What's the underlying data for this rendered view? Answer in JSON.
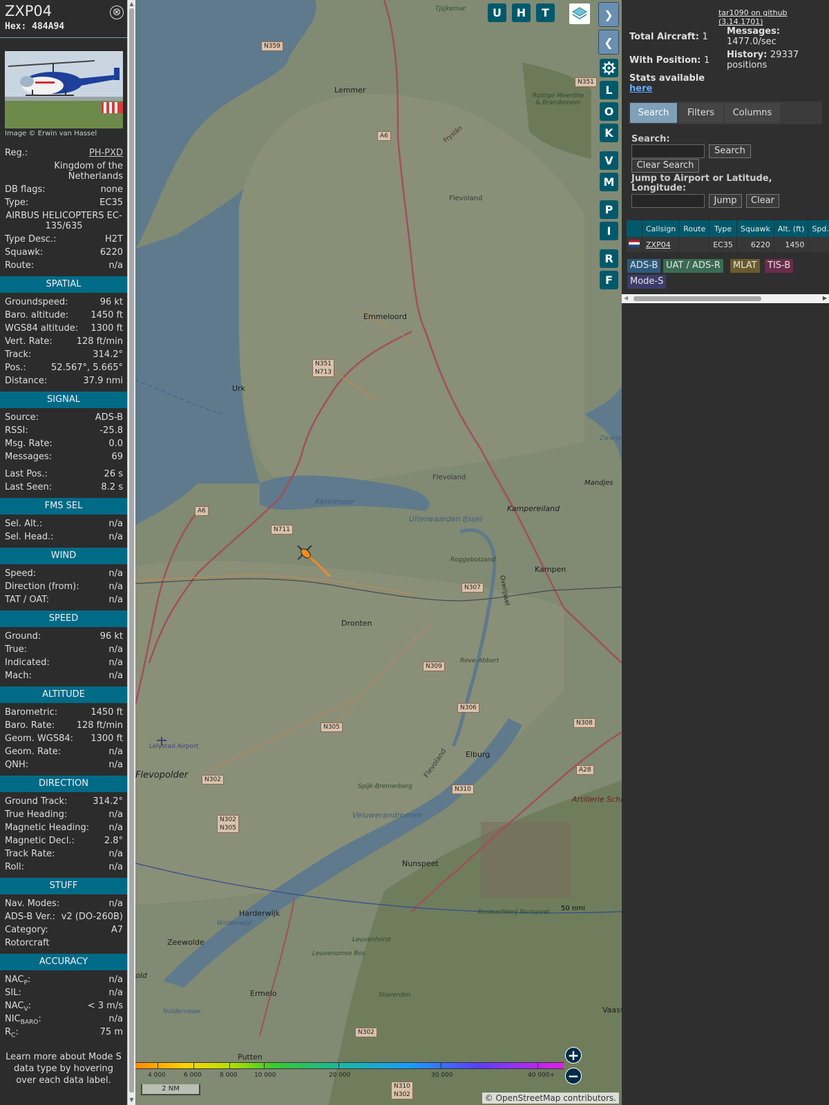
{
  "info": {
    "callsign": "ZXP04",
    "hex_label": "Hex:",
    "hex_value": "484A94",
    "close_glyph": "⊗",
    "photo_credit": "Image © Erwin van Hassel",
    "reg_label": "Reg.:",
    "reg_value": "PH-PXD",
    "country": "Kingdom of the Netherlands",
    "db_flags_label": "DB flags:",
    "db_flags_value": "none",
    "type_label": "Type:",
    "type_value": "EC35",
    "type_full": "AIRBUS HELICOPTERS EC-135/635",
    "type_desc_label": "Type Desc.:",
    "type_desc_value": "H2T",
    "squawk_label": "Squawk:",
    "squawk_value": "6220",
    "route_label": "Route:",
    "route_value": "n/a",
    "spatial_title": "SPATIAL",
    "groundspeed_label": "Groundspeed:",
    "groundspeed_value": "96 kt",
    "baro_alt_label": "Baro. altitude:",
    "baro_alt_value": "1450 ft",
    "wgs_alt_label": "WGS84 altitude:",
    "wgs_alt_value": "1300 ft",
    "vert_rate_label": "Vert. Rate:",
    "vert_rate_value": "128 ft/min",
    "track_label": "Track:",
    "track_value": "314.2°",
    "pos_label": "Pos.:",
    "pos_value": "52.567°, 5.665°",
    "distance_label": "Distance:",
    "distance_value": "37.9 nmi",
    "signal_title": "SIGNAL",
    "source_label": "Source:",
    "source_value": "ADS-B",
    "rssi_label": "RSSI:",
    "rssi_value": "-25.8",
    "msg_rate_label": "Msg. Rate:",
    "msg_rate_value": "0.0",
    "messages_label": "Messages:",
    "messages_value": "69",
    "last_pos_label": "Last Pos.:",
    "last_pos_value": "26 s",
    "last_seen_label": "Last Seen:",
    "last_seen_value": "8.2 s",
    "fms_title": "FMS SEL",
    "sel_alt_label": "Sel. Alt.:",
    "sel_alt_value": "n/a",
    "sel_head_label": "Sel. Head.:",
    "sel_head_value": "n/a",
    "wind_title": "WIND",
    "wind_speed_label": "Speed:",
    "wind_speed_value": "n/a",
    "wind_dir_label": "Direction (from):",
    "wind_dir_value": "n/a",
    "tat_label": "TAT / OAT:",
    "tat_value": "n/a",
    "speed_title": "SPEED",
    "ground_label": "Ground:",
    "ground_value": "96 kt",
    "true_label": "True:",
    "true_value": "n/a",
    "indicated_label": "Indicated:",
    "indicated_value": "n/a",
    "mach_label": "Mach:",
    "mach_value": "n/a",
    "altitude_title": "ALTITUDE",
    "barometric_label": "Barometric:",
    "barometric_value": "1450 ft",
    "baro_rate_label": "Baro. Rate:",
    "baro_rate_value": "128 ft/min",
    "geom_wgs_label": "Geom. WGS84:",
    "geom_wgs_value": "1300 ft",
    "geom_rate_label": "Geom. Rate:",
    "geom_rate_value": "n/a",
    "qnh_label": "QNH:",
    "qnh_value": "n/a",
    "direction_title": "DIRECTION",
    "ground_track_label": "Ground Track:",
    "ground_track_value": "314.2°",
    "true_heading_label": "True Heading:",
    "true_heading_value": "n/a",
    "mag_heading_label": "Magnetic Heading:",
    "mag_heading_value": "n/a",
    "mag_decl_label": "Magnetic Decl.:",
    "mag_decl_value": "2.8°",
    "track_rate_label": "Track Rate:",
    "track_rate_value": "n/a",
    "roll_label": "Roll:",
    "roll_value": "n/a",
    "stuff_title": "STUFF",
    "nav_modes_label": "Nav. Modes:",
    "nav_modes_value": "n/a",
    "adsb_ver_label": "ADS-B Ver.:",
    "adsb_ver_value": "v2 (DO-260B)",
    "category_label": "Category:",
    "category_value": "A7",
    "category_desc": "Rotorcraft",
    "accuracy_title": "ACCURACY",
    "nacp_label": "NAC",
    "nacp_sub": "P",
    "nacp_value": "n/a",
    "sil_label": "SIL:",
    "sil_value": "n/a",
    "nacv_label": "NAC",
    "nacv_sub": "V",
    "nacv_value": "< 3 m/s",
    "nic_label": "NIC",
    "nic_sub": "BARO",
    "nic_value": "n/a",
    "rc_label": "R",
    "rc_sub": "C",
    "rc_value": "75 m",
    "footer_note": "Learn more about Mode S data type by hovering over each data label."
  },
  "map": {
    "buttons": {
      "u": "U",
      "h": "H",
      "t": "T",
      "l": "L",
      "o": "O",
      "k": "K",
      "v": "V",
      "m": "M",
      "p": "P",
      "i": "I",
      "r": "R",
      "f": "F"
    },
    "toggle_glyph": "◂▸",
    "expand_glyph": "❯",
    "collapse_glyph": "❮",
    "settings_icon": "gear-icon",
    "layers_icon": "layers-icon",
    "zoom_in": "+",
    "zoom_out": "−",
    "scale_label": "2 NM",
    "range_ring_label": "50 nmi",
    "attribution": "© OpenStreetMap contributors.",
    "altitude_scale": [
      "4 000",
      "6 000",
      "8 000",
      "10 000",
      "20 000",
      "30 000",
      "40 000+"
    ],
    "places": {
      "lemmer": "Lemmer",
      "emmeloord": "Emmeloord",
      "urk": "Urk",
      "ketelmeer": "Ketelmeer",
      "uiterwaarden": "Uiterwaarden IJssel",
      "kampereiland": "Kampereiland",
      "kampen": "Kampen",
      "dronten": "Dronten",
      "flevoland1": "Flevoland",
      "flevoland2": "Flevoland",
      "flevoland3": "Flevoland",
      "reve": "Reve-Abbert",
      "roggebot": "Roggebotzand",
      "elburg": "Elburg",
      "lelystad": "Lelystad Airport",
      "flevopolder": "Flevopolder",
      "spijk": "Spijk-Bremerberg",
      "veluwe": "Veluwerandmeren",
      "nunspeet": "Nunspeet",
      "boswachterij": "Boswachterij Nunspeet",
      "harderwijk": "Harderwijk",
      "zeewolde": "Zeewolde",
      "ermelo": "Ermelo",
      "putten": "Putten",
      "leuvenhorst": "Leuvenhorst",
      "staverden": "Staverden",
      "leuvenumse": "Leuvenumse Bos",
      "wolderwijd": "Wolderwijd",
      "nuldernauw": "Nuldernauw",
      "artillerie": "Artillerie Schietkamp",
      "mandjes": "Mandjes",
      "zwarte": "Zwarte Meer",
      "rottige": "Rottige Meenthe & Brandemeer",
      "tjsjkemar": "Tjsjkemar",
      "fryslan": "Fryslân",
      "vaassen": "Vaass",
      "oold": "old",
      "overijssel": "Overijssel"
    },
    "roads": {
      "n359": "N359",
      "n351a": "N351",
      "n351b": "N351\nN713",
      "a6a": "A6",
      "a6b": "A6",
      "n711": "N711",
      "n307": "N307",
      "n309": "N309",
      "n306": "N306",
      "n305": "N305",
      "n302a": "N302",
      "n302b": "N302\nN305",
      "n310": "N310",
      "n308": "N308",
      "a28": "A28",
      "n302c": "N302",
      "n310b": "N310\nN302"
    }
  },
  "sidebar": {
    "github_link": "tar1090 on github (3.14.1701)",
    "total_aircraft_label": "Total Aircraft:",
    "total_aircraft_value": "1",
    "with_position_label": "With Position:",
    "with_position_value": "1",
    "messages_label": "Messages:",
    "messages_value": "1477.0/sec",
    "history_label": "History:",
    "history_value": "29337 positions",
    "stats_label": "Stats available",
    "stats_link": "here",
    "tabs": [
      "Search",
      "Filters",
      "Columns"
    ],
    "search_label": "Search:",
    "search_button": "Search",
    "clear_search_button": "Clear Search",
    "jump_label": "Jump to Airport or Latitude, Longitude:",
    "jump_button": "Jump",
    "clear_button": "Clear",
    "table_headers": [
      "",
      "Callsign",
      "Route",
      "Type",
      "Squawk",
      "Alt. (ft)",
      "Spd."
    ],
    "table_row": {
      "callsign": "ZXP04",
      "route": "",
      "type": "EC35",
      "squawk": "6220",
      "alt": "1450",
      "spd": ""
    },
    "sources": [
      {
        "label": "ADS-B",
        "color": "#2c5a7a"
      },
      {
        "label": "UAT / ADS-R",
        "color": "#3a6b52"
      },
      {
        "label": "MLAT",
        "color": "#6b5a2c"
      },
      {
        "label": "TIS-B",
        "color": "#6b2c4a"
      },
      {
        "label": "Mode-S",
        "color": "#3c3c6b"
      }
    ]
  }
}
